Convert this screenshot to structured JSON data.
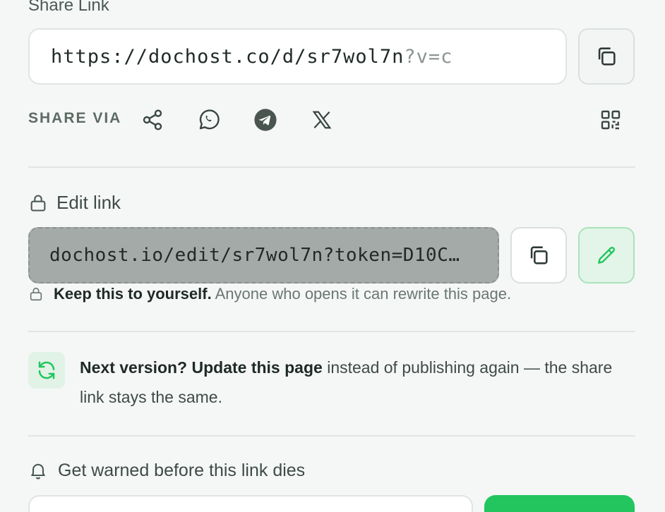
{
  "share": {
    "title": "Share Link",
    "url_main": "https://dochost.co/d/sr7wol7n",
    "url_tail": "?v=c",
    "share_via_label": "SHARE VIA",
    "icons": [
      "share-icon",
      "whatsapp-icon",
      "telegram-icon",
      "x-logo-icon",
      "qr-code-icon"
    ]
  },
  "edit": {
    "label": "Edit link",
    "url": "dochost.io/edit/sr7wol7n?token=D10C…",
    "warning_bold": "Keep this to yourself.",
    "warning_text": " Anyone who opens it can rewrite this page."
  },
  "update": {
    "bold": "Next version? Update this page",
    "text": " instead of publishing again — the share link stays the same."
  },
  "expiry": {
    "label": "Get warned before this link dies"
  },
  "colors": {
    "accent": "#22c55e",
    "accent_soft": "#e3f5e8",
    "background": "#f5f7f6"
  }
}
